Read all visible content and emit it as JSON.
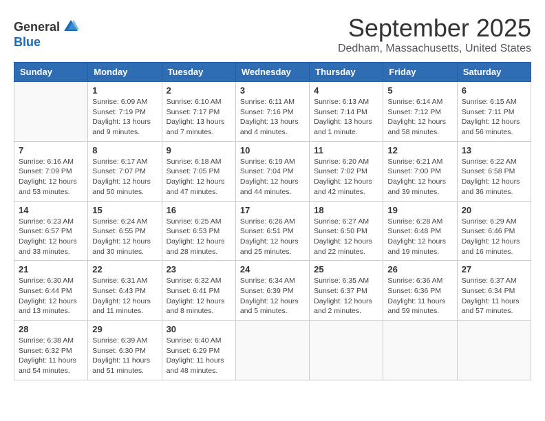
{
  "logo": {
    "general": "General",
    "blue": "Blue"
  },
  "title": "September 2025",
  "location": "Dedham, Massachusetts, United States",
  "days_of_week": [
    "Sunday",
    "Monday",
    "Tuesday",
    "Wednesday",
    "Thursday",
    "Friday",
    "Saturday"
  ],
  "weeks": [
    [
      {
        "day": "",
        "info": ""
      },
      {
        "day": "1",
        "info": "Sunrise: 6:09 AM\nSunset: 7:19 PM\nDaylight: 13 hours\nand 9 minutes."
      },
      {
        "day": "2",
        "info": "Sunrise: 6:10 AM\nSunset: 7:17 PM\nDaylight: 13 hours\nand 7 minutes."
      },
      {
        "day": "3",
        "info": "Sunrise: 6:11 AM\nSunset: 7:16 PM\nDaylight: 13 hours\nand 4 minutes."
      },
      {
        "day": "4",
        "info": "Sunrise: 6:13 AM\nSunset: 7:14 PM\nDaylight: 13 hours\nand 1 minute."
      },
      {
        "day": "5",
        "info": "Sunrise: 6:14 AM\nSunset: 7:12 PM\nDaylight: 12 hours\nand 58 minutes."
      },
      {
        "day": "6",
        "info": "Sunrise: 6:15 AM\nSunset: 7:11 PM\nDaylight: 12 hours\nand 56 minutes."
      }
    ],
    [
      {
        "day": "7",
        "info": "Sunrise: 6:16 AM\nSunset: 7:09 PM\nDaylight: 12 hours\nand 53 minutes."
      },
      {
        "day": "8",
        "info": "Sunrise: 6:17 AM\nSunset: 7:07 PM\nDaylight: 12 hours\nand 50 minutes."
      },
      {
        "day": "9",
        "info": "Sunrise: 6:18 AM\nSunset: 7:05 PM\nDaylight: 12 hours\nand 47 minutes."
      },
      {
        "day": "10",
        "info": "Sunrise: 6:19 AM\nSunset: 7:04 PM\nDaylight: 12 hours\nand 44 minutes."
      },
      {
        "day": "11",
        "info": "Sunrise: 6:20 AM\nSunset: 7:02 PM\nDaylight: 12 hours\nand 42 minutes."
      },
      {
        "day": "12",
        "info": "Sunrise: 6:21 AM\nSunset: 7:00 PM\nDaylight: 12 hours\nand 39 minutes."
      },
      {
        "day": "13",
        "info": "Sunrise: 6:22 AM\nSunset: 6:58 PM\nDaylight: 12 hours\nand 36 minutes."
      }
    ],
    [
      {
        "day": "14",
        "info": "Sunrise: 6:23 AM\nSunset: 6:57 PM\nDaylight: 12 hours\nand 33 minutes."
      },
      {
        "day": "15",
        "info": "Sunrise: 6:24 AM\nSunset: 6:55 PM\nDaylight: 12 hours\nand 30 minutes."
      },
      {
        "day": "16",
        "info": "Sunrise: 6:25 AM\nSunset: 6:53 PM\nDaylight: 12 hours\nand 28 minutes."
      },
      {
        "day": "17",
        "info": "Sunrise: 6:26 AM\nSunset: 6:51 PM\nDaylight: 12 hours\nand 25 minutes."
      },
      {
        "day": "18",
        "info": "Sunrise: 6:27 AM\nSunset: 6:50 PM\nDaylight: 12 hours\nand 22 minutes."
      },
      {
        "day": "19",
        "info": "Sunrise: 6:28 AM\nSunset: 6:48 PM\nDaylight: 12 hours\nand 19 minutes."
      },
      {
        "day": "20",
        "info": "Sunrise: 6:29 AM\nSunset: 6:46 PM\nDaylight: 12 hours\nand 16 minutes."
      }
    ],
    [
      {
        "day": "21",
        "info": "Sunrise: 6:30 AM\nSunset: 6:44 PM\nDaylight: 12 hours\nand 13 minutes."
      },
      {
        "day": "22",
        "info": "Sunrise: 6:31 AM\nSunset: 6:43 PM\nDaylight: 12 hours\nand 11 minutes."
      },
      {
        "day": "23",
        "info": "Sunrise: 6:32 AM\nSunset: 6:41 PM\nDaylight: 12 hours\nand 8 minutes."
      },
      {
        "day": "24",
        "info": "Sunrise: 6:34 AM\nSunset: 6:39 PM\nDaylight: 12 hours\nand 5 minutes."
      },
      {
        "day": "25",
        "info": "Sunrise: 6:35 AM\nSunset: 6:37 PM\nDaylight: 12 hours\nand 2 minutes."
      },
      {
        "day": "26",
        "info": "Sunrise: 6:36 AM\nSunset: 6:36 PM\nDaylight: 11 hours\nand 59 minutes."
      },
      {
        "day": "27",
        "info": "Sunrise: 6:37 AM\nSunset: 6:34 PM\nDaylight: 11 hours\nand 57 minutes."
      }
    ],
    [
      {
        "day": "28",
        "info": "Sunrise: 6:38 AM\nSunset: 6:32 PM\nDaylight: 11 hours\nand 54 minutes."
      },
      {
        "day": "29",
        "info": "Sunrise: 6:39 AM\nSunset: 6:30 PM\nDaylight: 11 hours\nand 51 minutes."
      },
      {
        "day": "30",
        "info": "Sunrise: 6:40 AM\nSunset: 6:29 PM\nDaylight: 11 hours\nand 48 minutes."
      },
      {
        "day": "",
        "info": ""
      },
      {
        "day": "",
        "info": ""
      },
      {
        "day": "",
        "info": ""
      },
      {
        "day": "",
        "info": ""
      }
    ]
  ]
}
